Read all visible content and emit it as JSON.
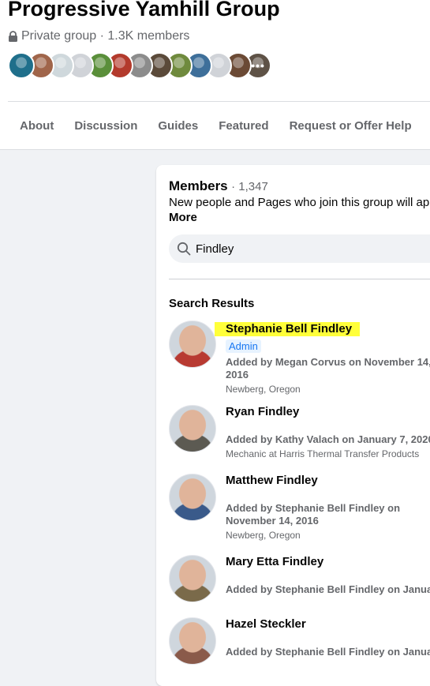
{
  "group": {
    "title": "Progressive Yamhill Group",
    "privacy": "Private group",
    "member_summary": "1.3K members",
    "avatar_colors": [
      "#1f6f8b",
      "#a0654a",
      "#cfd8dc",
      "#d0d3d8",
      "#5a8f3a",
      "#b33a2c",
      "#8c8c8c",
      "#5b4a3a",
      "#6f8a3d",
      "#3e6f9a",
      "#d0d3d8",
      "#6b4a35",
      "#5e5246"
    ]
  },
  "tabs": [
    {
      "label": "About"
    },
    {
      "label": "Discussion"
    },
    {
      "label": "Guides"
    },
    {
      "label": "Featured"
    },
    {
      "label": "Request or Offer Help"
    }
  ],
  "members_panel": {
    "title": "Members",
    "count": "1,347",
    "description": "New people and Pages who join this group will ap",
    "more_label": "More",
    "search": {
      "value": "Findley"
    },
    "results_label": "Search Results"
  },
  "members": [
    {
      "name": "Stephanie Bell Findley",
      "badge": "Admin",
      "added_line1": "Added by Megan Corvus on November 14,",
      "added_line2": "2016",
      "detail": "Newberg, Oregon",
      "avatar_color": "#b83a32"
    },
    {
      "name": "Ryan Findley",
      "added_line1": "Added by Kathy Valach on January 7, 2020",
      "detail": "Mechanic at Harris Thermal Transfer Products",
      "avatar_color": "#5c5a52"
    },
    {
      "name": "Matthew Findley",
      "added_line1": "Added by Stephanie Bell Findley on",
      "added_line2": "November 14, 2016",
      "detail": "Newberg, Oregon",
      "avatar_color": "#3a5a8a"
    },
    {
      "name": "Mary Etta Findley",
      "added_line1": "Added by Stephanie Bell Findley on January",
      "avatar_color": "#7a6a4a"
    },
    {
      "name": "Hazel Steckler",
      "added_line1": "Added by Stephanie Bell Findley on January",
      "avatar_color": "#8a5a4a"
    }
  ]
}
